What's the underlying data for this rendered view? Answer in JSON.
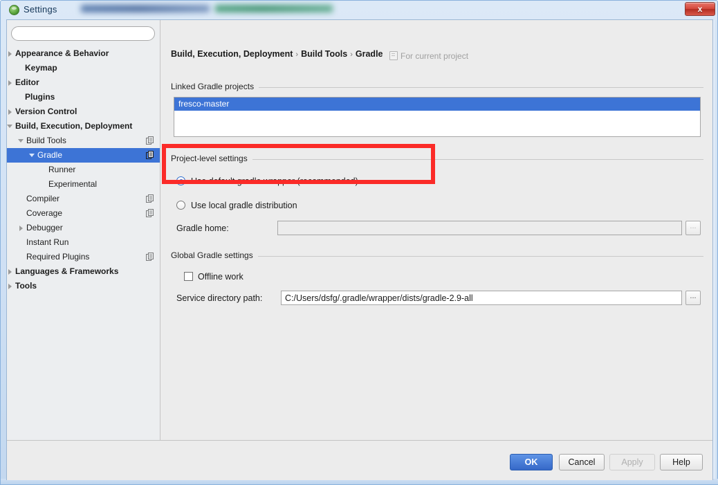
{
  "window": {
    "title": "Settings",
    "title_icon": "ide-logo-icon",
    "blurred_title_present": true,
    "close_label": "x"
  },
  "sidebar": {
    "search": {
      "value": "",
      "placeholder": ""
    },
    "items": [
      {
        "label": "Appearance & Behavior",
        "indent": 12,
        "bold": true,
        "twisty": "right",
        "copy": false,
        "selected": false
      },
      {
        "label": "Keymap",
        "indent": 26,
        "bold": true,
        "twisty": "none",
        "copy": false,
        "selected": false
      },
      {
        "label": "Editor",
        "indent": 12,
        "bold": true,
        "twisty": "right",
        "copy": false,
        "selected": false
      },
      {
        "label": "Plugins",
        "indent": 26,
        "bold": true,
        "twisty": "none",
        "copy": false,
        "selected": false
      },
      {
        "label": "Version Control",
        "indent": 12,
        "bold": true,
        "twisty": "right",
        "copy": false,
        "selected": false
      },
      {
        "label": "Build, Execution, Deployment",
        "indent": 12,
        "bold": true,
        "twisty": "down",
        "copy": false,
        "selected": false
      },
      {
        "label": "Build Tools",
        "indent": 28,
        "bold": false,
        "twisty": "down",
        "copy": true,
        "selected": false
      },
      {
        "label": "Gradle",
        "indent": 44,
        "bold": false,
        "twisty": "down",
        "copy": true,
        "selected": true
      },
      {
        "label": "Runner",
        "indent": 60,
        "bold": false,
        "twisty": "none",
        "copy": false,
        "selected": false
      },
      {
        "label": "Experimental",
        "indent": 60,
        "bold": false,
        "twisty": "none",
        "copy": false,
        "selected": false
      },
      {
        "label": "Compiler",
        "indent": 28,
        "bold": false,
        "twisty": "none",
        "copy": true,
        "selected": false
      },
      {
        "label": "Coverage",
        "indent": 28,
        "bold": false,
        "twisty": "none",
        "copy": true,
        "selected": false
      },
      {
        "label": "Debugger",
        "indent": 28,
        "bold": false,
        "twisty": "right",
        "copy": false,
        "selected": false
      },
      {
        "label": "Instant Run",
        "indent": 28,
        "bold": false,
        "twisty": "none",
        "copy": false,
        "selected": false
      },
      {
        "label": "Required Plugins",
        "indent": 28,
        "bold": false,
        "twisty": "none",
        "copy": true,
        "selected": false
      },
      {
        "label": "Languages & Frameworks",
        "indent": 12,
        "bold": true,
        "twisty": "right",
        "copy": false,
        "selected": false
      },
      {
        "label": "Tools",
        "indent": 12,
        "bold": true,
        "twisty": "right",
        "copy": false,
        "selected": false
      }
    ]
  },
  "content": {
    "breadcrumb": {
      "parts": [
        "Build, Execution, Deployment",
        "Build Tools",
        "Gradle"
      ],
      "separator": "›"
    },
    "for_current_project": "For current project",
    "groups": {
      "linked_projects": "Linked Gradle projects",
      "project_level": "Project-level settings",
      "global_settings": "Global Gradle settings"
    },
    "linked_projects": {
      "items": [
        {
          "label": "fresco-master",
          "selected": true
        }
      ]
    },
    "radios": [
      {
        "label": "Use default gradle wrapper (recommended)",
        "checked": true
      },
      {
        "label": "Use local gradle distribution",
        "checked": false
      }
    ],
    "gradle_home": {
      "label": "Gradle home:",
      "value": "",
      "disabled": true,
      "browse_label": "..."
    },
    "offline_work": {
      "label": "Offline work",
      "checked": false
    },
    "service_directory": {
      "label": "Service directory path:",
      "value": "C:/Users/dsfg/.gradle/wrapper/dists/gradle-2.9-all",
      "browse_label": "..."
    }
  },
  "buttons": {
    "ok": "OK",
    "cancel": "Cancel",
    "apply": "Apply",
    "help": "Help"
  },
  "annotation": {
    "type": "highlight-rectangle",
    "color": "#fb2b28"
  },
  "colors": {
    "selection_blue": "#3d74d6",
    "default_button_blue": "#3568c8",
    "annotation_red": "#fb2b28",
    "panel_gray": "#ececec"
  }
}
